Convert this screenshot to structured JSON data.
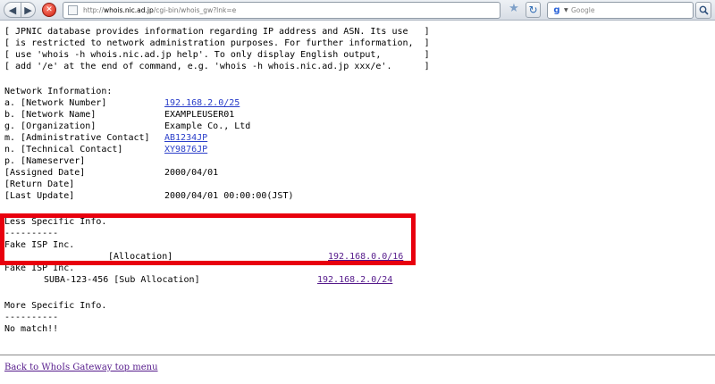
{
  "browser": {
    "url_prefix": "http://",
    "url_host": "whois.nic.ad.jp",
    "url_path": "/cgi-bin/whois_gw?lnk=e",
    "search_placeholder": "Google",
    "search_engine_icon": "google-icon"
  },
  "notice": [
    "[ JPNIC database provides information regarding IP address and ASN. Its use   ]",
    "[ is restricted to network administration purposes. For further information,  ]",
    "[ use 'whois -h whois.nic.ad.jp help'. To only display English output,        ]",
    "[ add '/e' at the end of command, e.g. 'whois -h whois.nic.ad.jp xxx/e'.      ]"
  ],
  "network": {
    "heading": "Network Information:",
    "fields": [
      {
        "label": "a. [Network Number]",
        "value": "192.168.2.0/25",
        "link": true
      },
      {
        "label": "b. [Network Name]",
        "value": "EXAMPLEUSER01",
        "link": false
      },
      {
        "label": "g. [Organization]",
        "value": "Example Co., Ltd",
        "link": false
      },
      {
        "label": "m. [Administrative Contact]",
        "value": "AB1234JP",
        "link": true
      },
      {
        "label": "n. [Technical Contact]",
        "value": "XY9876JP",
        "link": true
      },
      {
        "label": "p. [Nameserver]",
        "value": "",
        "link": false
      },
      {
        "label": "[Assigned Date]",
        "value": "2000/04/01",
        "link": false
      },
      {
        "label": "[Return Date]",
        "value": "",
        "link": false
      },
      {
        "label": "[Last Update]",
        "value": "2000/04/01 00:00:00(JST)",
        "link": false
      }
    ]
  },
  "less_specific": {
    "heading": "Less Specific Info.",
    "divider": "----------",
    "entries": [
      {
        "org": "Fake ISP Inc.",
        "type": "[Allocation]",
        "network": "192.168.0.0/16"
      },
      {
        "org": "Fake ISP Inc.",
        "type": "SUBA-123-456 [Sub Allocation]",
        "network": "192.168.2.0/24"
      }
    ]
  },
  "more_specific": {
    "heading": "More Specific Info.",
    "divider": "----------",
    "result": "No match!!"
  },
  "footer": {
    "back_link": "Back to WhoIs Gateway top menu"
  }
}
